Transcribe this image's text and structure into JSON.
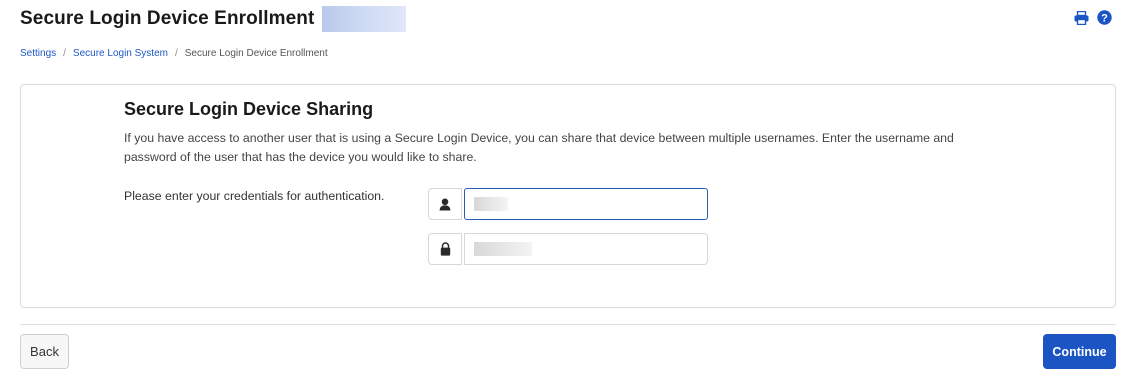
{
  "header": {
    "title": "Secure Login Device Enrollment",
    "actions": [
      {
        "name": "print-icon",
        "icon": "printer"
      },
      {
        "name": "help-icon",
        "icon": "question-circle"
      }
    ]
  },
  "breadcrumb": {
    "items": [
      {
        "label": "Settings",
        "link": true
      },
      {
        "label": "Secure Login System",
        "link": true
      },
      {
        "label": "Secure Login Device Enrollment",
        "link": false
      }
    ],
    "separator": "/"
  },
  "card": {
    "title": "Secure Login Device Sharing",
    "description": "If you have access to another user that is using a Secure Login Device, you can share that device between multiple usernames. Enter the username and password of the user that has the device you would like to share.",
    "credentials_label": "Please enter your credentials for authentication.",
    "username_field": {
      "icon": "user-icon",
      "value": ""
    },
    "password_field": {
      "icon": "lock-icon",
      "value": ""
    }
  },
  "footer": {
    "back_label": "Back",
    "continue_label": "Continue"
  },
  "colors": {
    "accent": "#1b55c3",
    "link": "#1d59c4",
    "focus_border": "#2a5db0"
  }
}
